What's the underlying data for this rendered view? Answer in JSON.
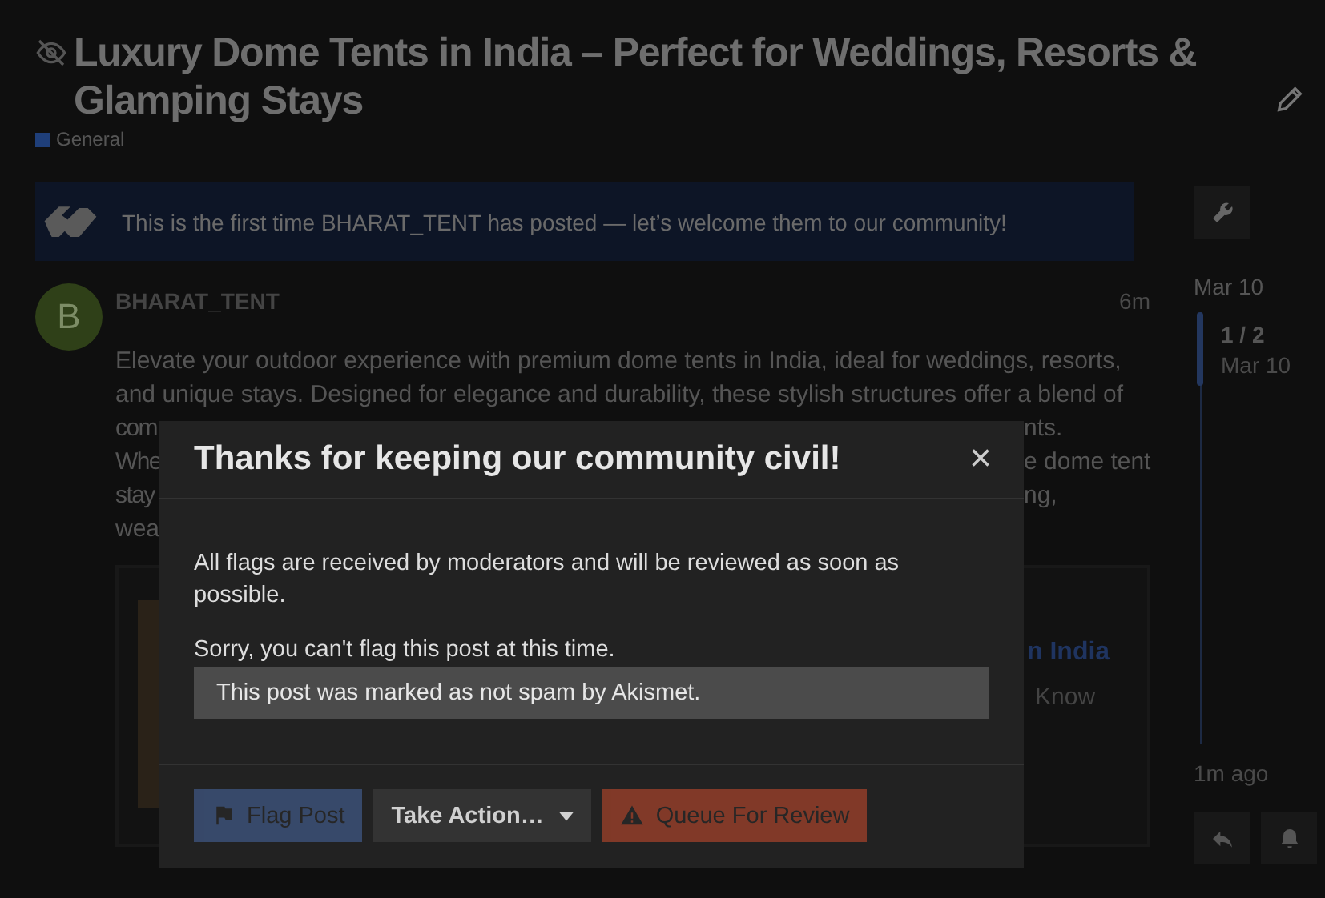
{
  "topic": {
    "title": "Luxury Dome Tents in India – Perfect for Weddings, Resorts & Glamping Stays",
    "category": {
      "name": "General",
      "color": "#1f3f7a"
    }
  },
  "welcome_banner": {
    "text": "This is the first time BHARAT_TENT has posted — let’s welcome them to our community!"
  },
  "post": {
    "avatar_letter": "B",
    "username": "BHARAT_TENT",
    "age": "6m",
    "lines": [
      {
        "left": "Elevate your outdoor experience with premium dome tents in India, ideal for weddings, resorts,"
      },
      {
        "left": "and unique stays. Designed for elegance and durability, these stylish structures offer a blend of"
      },
      {
        "left": "com",
        "right": "nts."
      },
      {
        "left": "Whe",
        "right": "e dome tent"
      },
      {
        "left": "stay",
        "right": "ng,"
      },
      {
        "left": "wea"
      }
    ],
    "onebox": {
      "title_fragment": "n India",
      "text_fragment": "Know"
    }
  },
  "timeline": {
    "start_date": "Mar 10",
    "position": "1 / 2",
    "position_date": "Mar 10",
    "last_activity": "1m ago"
  },
  "modal": {
    "title": "Thanks for keeping our community civil!",
    "close": "×",
    "message": "All flags are received by moderators and will be reviewed as soon as possible.",
    "notice": "Sorry, you can't flag this post at this time.",
    "reason": "This post was marked as not spam by Akismet.",
    "buttons": [
      {
        "kind": "flag",
        "label": "Flag Post",
        "disabled": true
      },
      {
        "kind": "menu",
        "label": "Take Action…",
        "disabled": false
      },
      {
        "kind": "queue",
        "label": "Queue For Review",
        "disabled": true
      }
    ]
  }
}
